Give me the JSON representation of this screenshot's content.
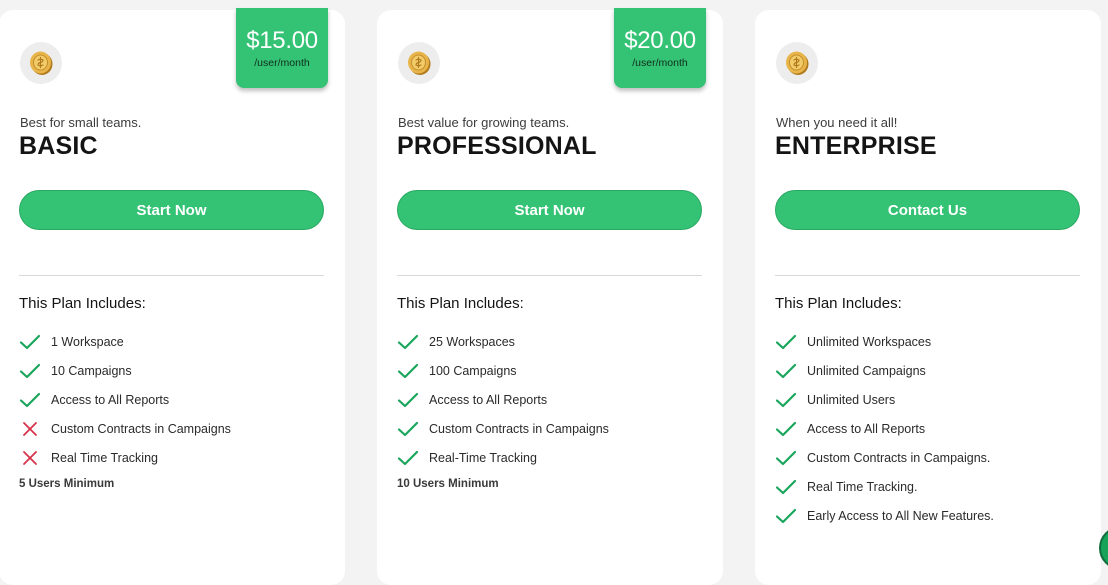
{
  "colors": {
    "accent": "#34c374",
    "check": "#1aa55c",
    "cross": "#d8324a"
  },
  "plans": [
    {
      "icon": "coin-icon",
      "price": "$15.00",
      "period": "/user/month",
      "tagline": "Best for small teams.",
      "name": "BASIC",
      "cta": "Start Now",
      "includes_title": "This Plan Includes:",
      "features": [
        {
          "text": "1 Workspace",
          "included": true
        },
        {
          "text": "10 Campaigns",
          "included": true
        },
        {
          "text": "Access to All Reports",
          "included": true
        },
        {
          "text": "Custom Contracts in Campaigns",
          "included": false
        },
        {
          "text": "Real Time Tracking",
          "included": false
        }
      ],
      "min_users": "5 Users Minimum"
    },
    {
      "icon": "coin-icon",
      "price": "$20.00",
      "period": "/user/month",
      "tagline": "Best value for growing teams.",
      "name": "PROFESSIONAL",
      "cta": "Start Now",
      "includes_title": "This Plan Includes:",
      "features": [
        {
          "text": "25 Workspaces",
          "included": true
        },
        {
          "text": "100 Campaigns",
          "included": true
        },
        {
          "text": "Access to All Reports",
          "included": true
        },
        {
          "text": "Custom Contracts in Campaigns",
          "included": true
        },
        {
          "text": "Real-Time Tracking",
          "included": true
        }
      ],
      "min_users": "10 Users Minimum"
    },
    {
      "icon": "coin-icon",
      "tagline": "When you need it all!",
      "name": "ENTERPRISE",
      "cta": "Contact Us",
      "includes_title": "This Plan Includes:",
      "features": [
        {
          "text": "Unlimited Workspaces",
          "included": true
        },
        {
          "text": "Unlimited Campaigns",
          "included": true
        },
        {
          "text": "Unlimited Users",
          "included": true
        },
        {
          "text": "Access to All Reports",
          "included": true
        },
        {
          "text": "Custom Contracts in Campaigns.",
          "included": true
        },
        {
          "text": "Real Time Tracking.",
          "included": true
        },
        {
          "text": "Early Access to All New Features.",
          "included": true
        }
      ]
    }
  ],
  "chat": {
    "icon": "chat-icon"
  }
}
